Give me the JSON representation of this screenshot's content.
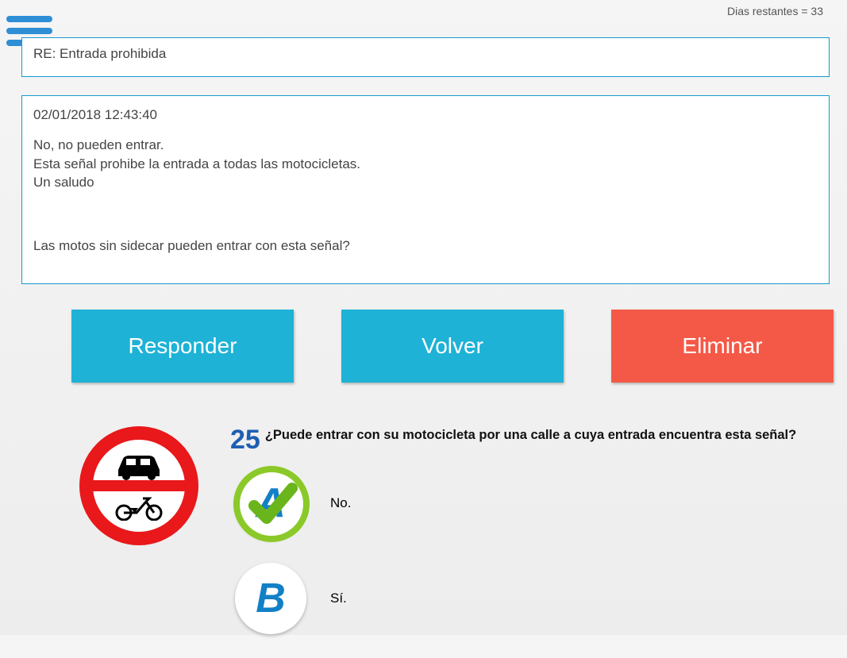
{
  "header": {
    "days_remaining": "Dias restantes = 33"
  },
  "subject": {
    "text": "RE: Entrada prohibida"
  },
  "message": {
    "timestamp": "02/01/2018 12:43:40",
    "line1": "No, no pueden entrar.",
    "line2": "Esta señal prohibe la entrada a todas las motocicletas.",
    "line3": "Un saludo",
    "question_text": "Las motos sin sidecar pueden entrar con esta señal?"
  },
  "buttons": {
    "responder": "Responder",
    "volver": "Volver",
    "eliminar": "Eliminar"
  },
  "quiz": {
    "number": "25",
    "text": "¿Puede entrar con su motocicleta por una calle a cuya entrada encuentra esta señal?",
    "answers": {
      "a": {
        "letter": "A",
        "text": "No.",
        "correct": true
      },
      "b": {
        "letter": "B",
        "text": "Sí.",
        "correct": false
      }
    }
  }
}
